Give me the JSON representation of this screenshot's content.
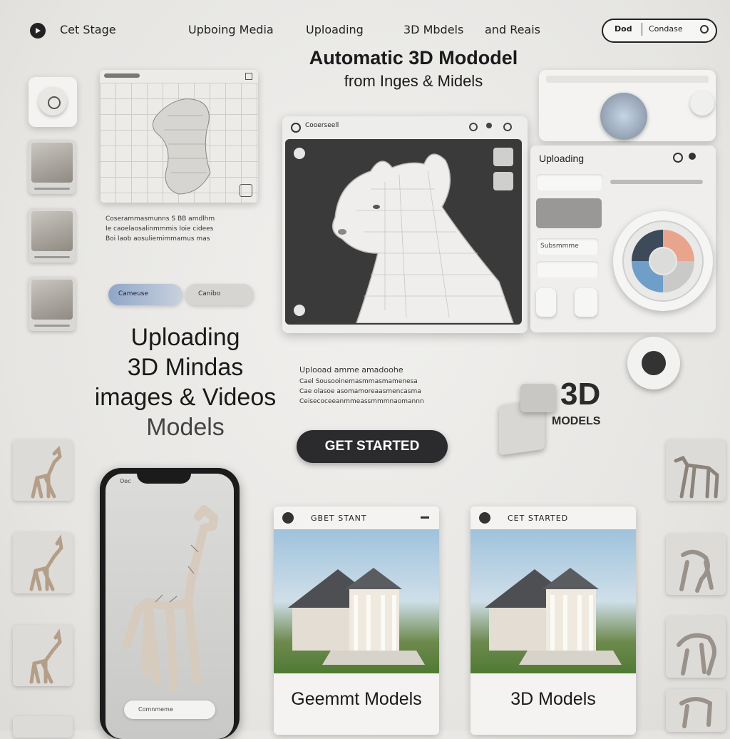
{
  "nav": {
    "brand": "Cet Stage",
    "links": [
      "Upboing Media",
      "Uploading",
      "3D Mbdels",
      "and Reais"
    ],
    "pill_left": "Dod",
    "pill_right": "Condase"
  },
  "headline": {
    "line1": "Automatic 3D Mododel",
    "line2": "from Inges & Midels"
  },
  "wire_card": {
    "caption_lines": [
      "Coserammasmunns S BB amdlhm",
      "Ie caoelaosalinmmmis Ioie cidees",
      "Boi laob aosuliemimmamus mas"
    ],
    "pill_left": "Cameuse",
    "pill_right": "Canibo"
  },
  "big_text": {
    "line1": "Uploading",
    "line2": "3D Mindas",
    "line3": "images & Videos",
    "line4": "Models"
  },
  "main_window": {
    "title": "Cooerseell"
  },
  "right_panel": {
    "title": "Uploading",
    "field_label": "Subsmmme"
  },
  "promo": {
    "heading": "Uplooad amme amadoohe",
    "lines": [
      "Cael Sousooinemasmmasmamenesa",
      "Cae olasoe asomamoreaasmencasma",
      "Ceisecoceeanmmeassmmmnaomannn"
    ],
    "badge_line1": "3D",
    "badge_line2": "MODELS"
  },
  "cta": {
    "label": "GET STARTED"
  },
  "phone": {
    "status": "Oec",
    "bottom_button": "Comnmeme"
  },
  "house_cards": [
    {
      "header": "GBET STANT",
      "title": "Geemmt Models"
    },
    {
      "header": "CET STARTED",
      "title": "3D Models"
    }
  ]
}
